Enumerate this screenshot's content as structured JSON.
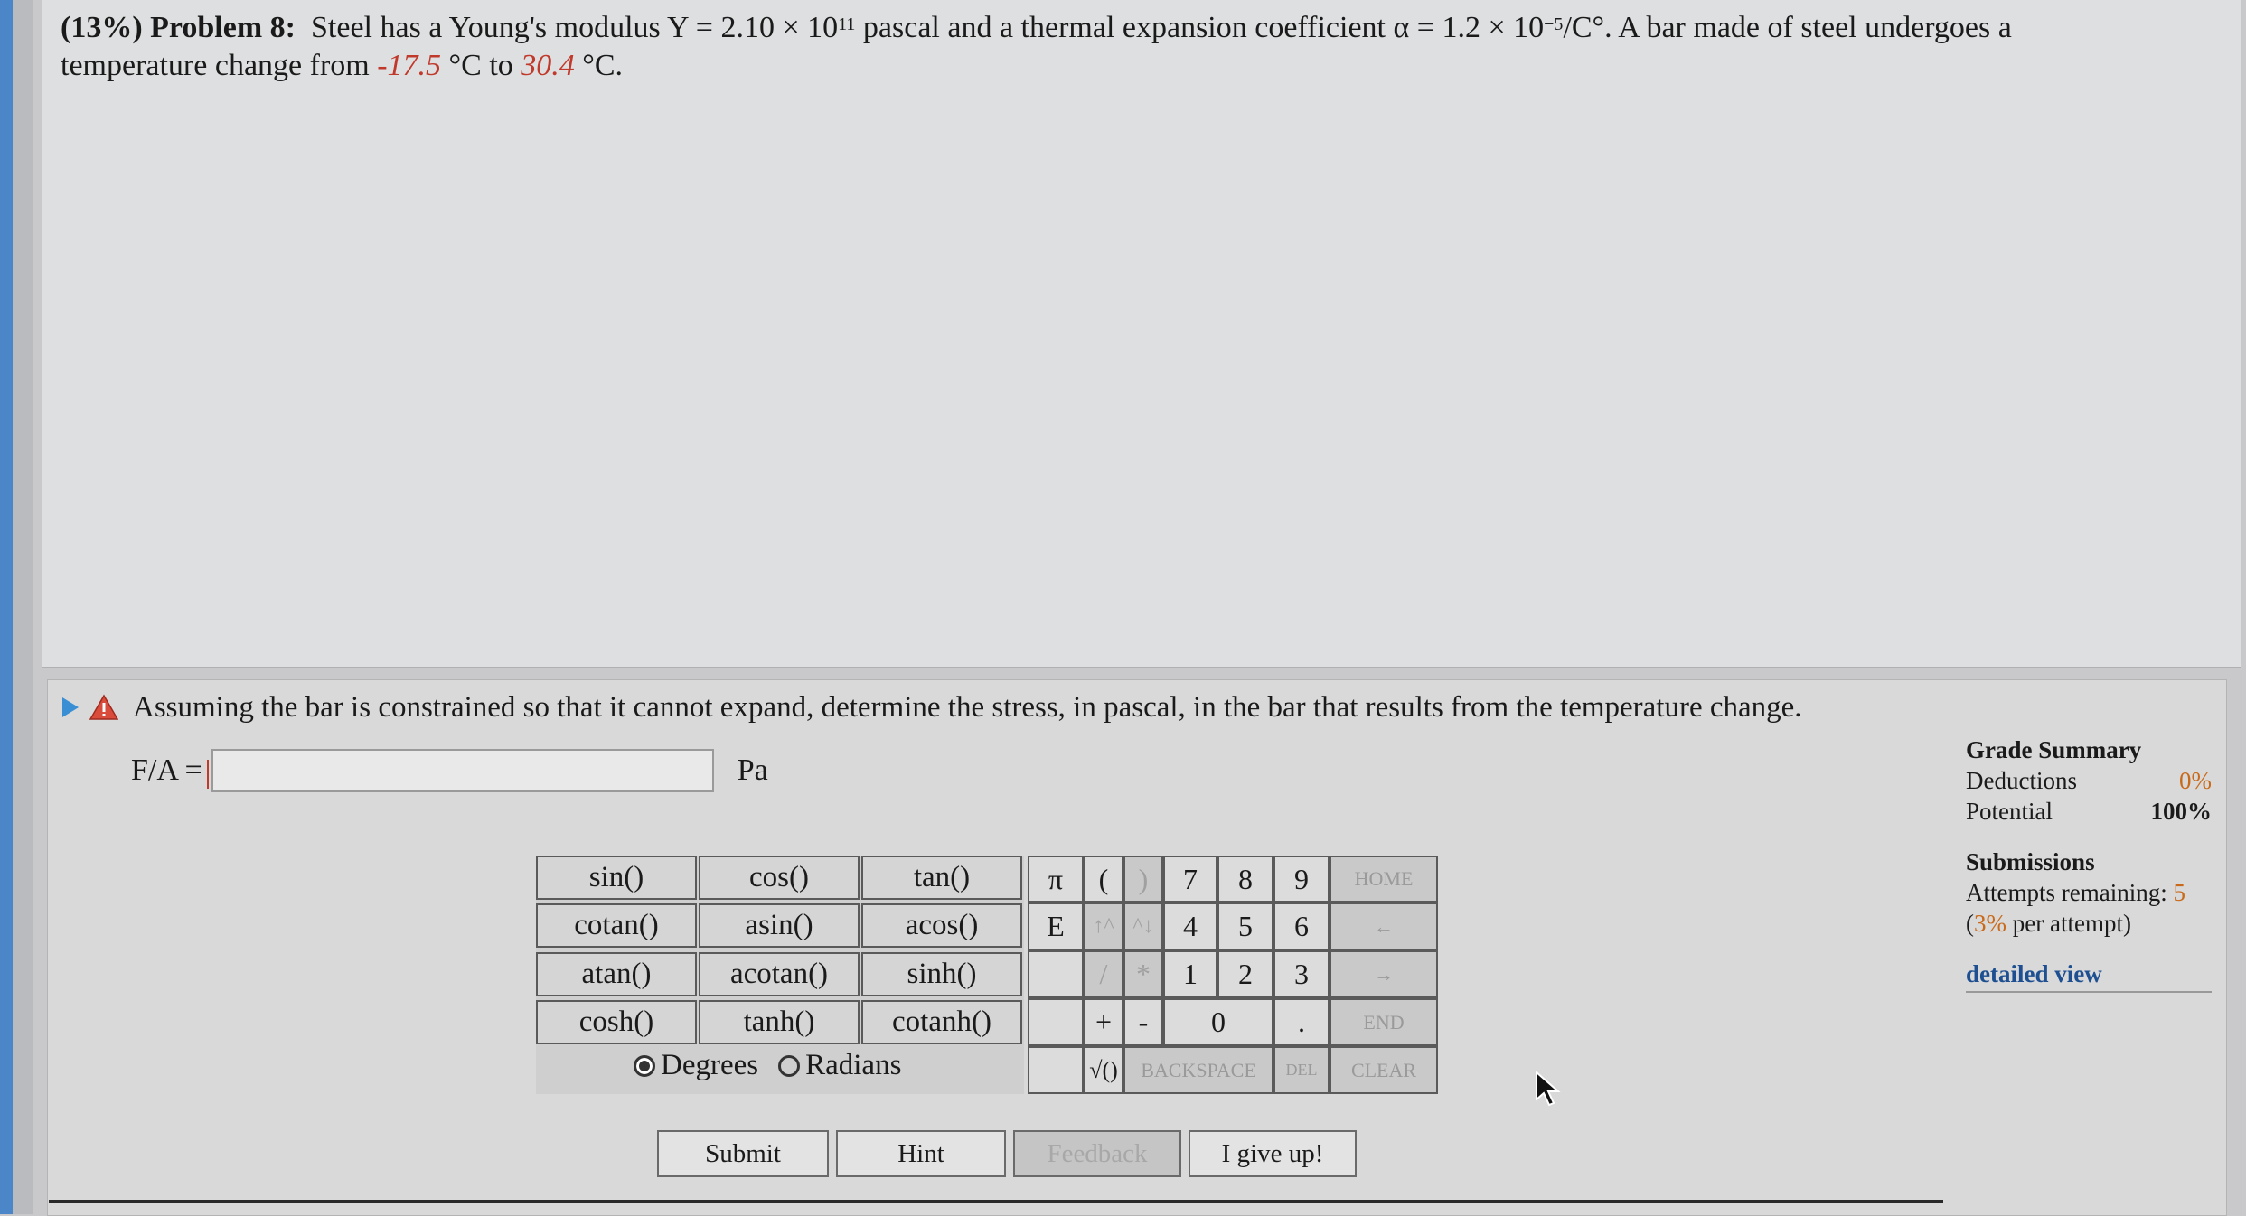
{
  "problem": {
    "percent": "(13%)",
    "title": "Problem 8:",
    "text_a": "Steel has a Young's modulus Y = 2.10 × 10",
    "exp_a": "11",
    "text_b": "pascal and a thermal expansion coefficient α = 1.2 × 10",
    "exp_b": "−5",
    "text_c": "/C°. A bar made of steel undergoes a",
    "text_d": "temperature change from",
    "t1": "-17.5",
    "unit1": "°C to",
    "t2": "30.4",
    "unit2": "°C."
  },
  "part": {
    "question": "Assuming the bar is constrained so that it cannot expand, determine the stress, in pascal, in the bar that results from the temperature change.",
    "answer_label": "F/A =",
    "answer_value": "",
    "unit": "Pa"
  },
  "grade": {
    "title": "Grade Summary",
    "deductions_label": "Deductions",
    "deductions_value": "0%",
    "potential_label": "Potential",
    "potential_value": "100%",
    "submissions_title": "Submissions",
    "attempts_label": "Attempts remaining:",
    "attempts_value": "5",
    "per_attempt_open": "(",
    "per_attempt_pct": "3%",
    "per_attempt_rest": "per attempt)",
    "detailed_view": "detailed view"
  },
  "calculator": {
    "functions": [
      "sin()",
      "cos()",
      "tan()",
      "cotan()",
      "asin()",
      "acos()",
      "atan()",
      "acotan()",
      "sinh()",
      "cosh()",
      "tanh()",
      "cotanh()"
    ],
    "degrees": "Degrees",
    "radians": "Radians",
    "angle_mode": "Degrees",
    "keys": {
      "pi": "π",
      "lparen": "(",
      "rparen": ")",
      "k7": "7",
      "k8": "8",
      "k9": "9",
      "home": "HOME",
      "e": "E",
      "up": "↑^",
      "down": "^↓",
      "k4": "4",
      "k5": "5",
      "k6": "6",
      "left": "←",
      "div": "/",
      "mul": "*",
      "k1": "1",
      "k2": "2",
      "k3": "3",
      "right": "→",
      "plus": "+",
      "minus": "-",
      "k0": "0",
      "dot": ".",
      "end": "END",
      "sqrt": "√()",
      "backspace": "BACKSPACE",
      "del": "DEL",
      "clear": "CLEAR"
    }
  },
  "actions": {
    "submit": "Submit",
    "hint": "Hint",
    "feedback": "Feedback",
    "give_up": "I give up!"
  }
}
